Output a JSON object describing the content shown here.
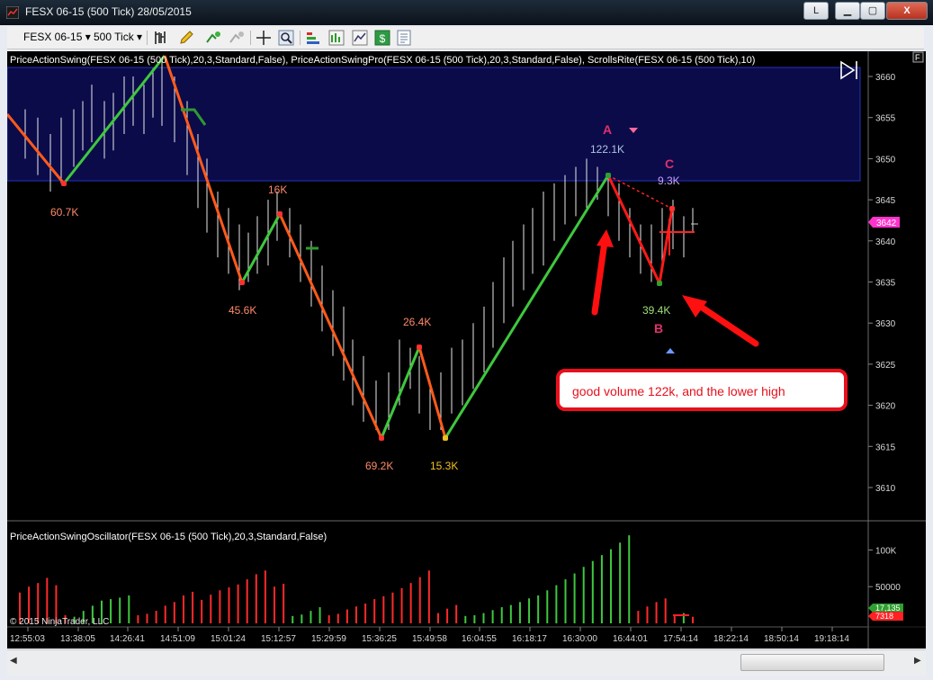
{
  "window": {
    "title": "FESX 06-15 (500 Tick)  28/05/2015",
    "link_label": "L",
    "minimize_label": "▁",
    "maximize_label": "▢",
    "close_label": "X"
  },
  "toolbar": {
    "instrument": "FESX 06-15",
    "interval": "500 Tick",
    "icons": [
      "bar-style-icon",
      "drawing-pencil-icon",
      "add-indicator-icon",
      "remove-indicator-icon",
      "crosshair-icon",
      "zoom-icon",
      "strategies-icon",
      "chart-trader-icon",
      "data-box-icon",
      "dollar-icon",
      "properties-icon"
    ]
  },
  "chart": {
    "corner_label": "F",
    "indicator_label": "PriceActionSwing(FESX 06-15 (500 Tick),20,3,Standard,False), PriceActionSwingPro(FESX 06-15 (500 Tick),20,3,Standard,False), ScrollsRite(FESX 06-15 (500 Tick),10)",
    "oscillator_label": "PriceActionSwingOscillator(FESX 06-15 (500 Tick),20,3,Standard,False)",
    "copyright": "© 2015 NinjaTrader, LLC",
    "price_axis": [
      "3660",
      "3655",
      "3650",
      "3645",
      "3640",
      "3635",
      "3630",
      "3625",
      "3620",
      "3615",
      "3610"
    ],
    "price_marker": "3642",
    "volume_axis": [
      "100K",
      "50000"
    ],
    "volume_markers": [
      "17,135",
      "7318"
    ],
    "time_axis": [
      "12:55:03",
      "13:38:05",
      "14:26:41",
      "14:51:09",
      "15:01:24",
      "15:12:57",
      "15:29:59",
      "15:36:25",
      "15:49:58",
      "16:04:55",
      "16:18:17",
      "16:30:00",
      "16:44:01",
      "17:54:14",
      "18:22:14",
      "18:50:14",
      "19:18:14"
    ],
    "swing_labels": [
      "60.7K",
      "16K",
      "45.6K",
      "26.4K",
      "69.2K",
      "15.3K",
      "122.1K",
      "9.3K",
      "39.4K"
    ],
    "point_letters": [
      "A",
      "C",
      "B"
    ],
    "annotation": "good volume 122k, and the lower high",
    "colors": {
      "up": "#3ec83e",
      "down": "#ff5a1a",
      "zone": "#0b0b4a",
      "annotation": "#e8101c"
    }
  },
  "chart_data": {
    "type": "bar",
    "ylabel": "",
    "ylim": [
      3605,
      3662
    ],
    "price_swings": [
      {
        "time": "12:55:03",
        "price": 3655
      },
      {
        "time": "13:38:05",
        "price": 3647
      },
      {
        "time": "14:26:41",
        "price": 3663
      },
      {
        "time": "15:01:24",
        "price": 3635
      },
      {
        "time": "15:12:57",
        "price": 3643
      },
      {
        "time": "15:36:25",
        "price": 3616
      },
      {
        "time": "15:44:00",
        "price": 3627
      },
      {
        "time": "15:49:58",
        "price": 3616
      },
      {
        "time": "16:30:00",
        "price": 3648
      },
      {
        "time": "16:40:00",
        "price": 3635
      },
      {
        "time": "16:50:00",
        "price": 3644
      }
    ],
    "oscillator": {
      "ylim": [
        0,
        130000
      ],
      "values": [
        -42000,
        -50000,
        -55000,
        -62000,
        -52000,
        -11000,
        9000,
        17000,
        24000,
        31000,
        33000,
        35000,
        38000,
        -11000,
        -13000,
        -17000,
        -24000,
        -29000,
        -38000,
        -43000,
        -32000,
        -39000,
        -45000,
        -49000,
        -53000,
        -60000,
        -67000,
        -72000,
        -50000,
        -54000,
        10000,
        12000,
        17000,
        22000,
        -11000,
        -13000,
        -19000,
        -23000,
        -27000,
        -33000,
        -37000,
        -42000,
        -48000,
        -55000,
        -63000,
        -72000,
        -14000,
        -20000,
        -25000,
        10000,
        11000,
        14000,
        18000,
        22000,
        25000,
        29000,
        34000,
        38000,
        45000,
        52000,
        60000,
        68000,
        77000,
        85000,
        93000,
        101000,
        110000,
        120000,
        -17000,
        -23000,
        -29000,
        -34000,
        -12000,
        14000,
        -9000
      ]
    }
  }
}
